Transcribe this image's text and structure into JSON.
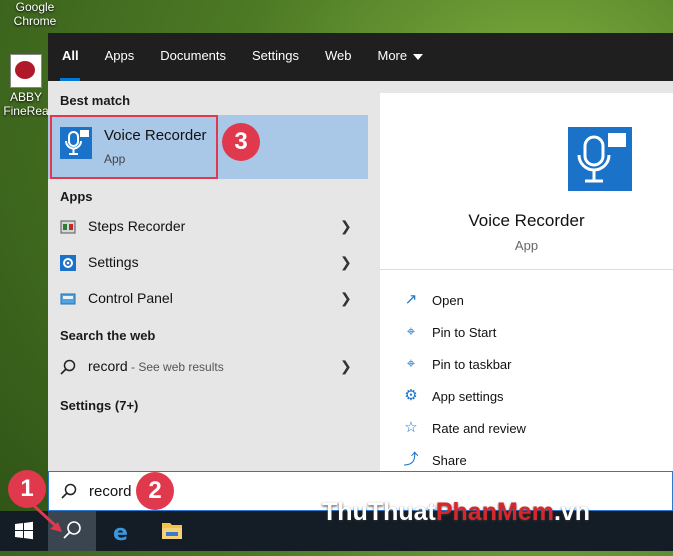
{
  "desktop": {
    "chrome_label": "Google Chrome",
    "abbyy_label_1": "ABBY",
    "abbyy_label_2": "FineRea"
  },
  "tabs": {
    "items": [
      {
        "label": "All"
      },
      {
        "label": "Apps"
      },
      {
        "label": "Documents"
      },
      {
        "label": "Settings"
      },
      {
        "label": "Web"
      },
      {
        "label": "More"
      }
    ]
  },
  "left": {
    "best_match_header": "Best match",
    "best": {
      "title": "Voice Recorder",
      "sub": "App"
    },
    "apps_header": "Apps",
    "apps": [
      {
        "label": "Steps Recorder"
      },
      {
        "label": "Settings"
      },
      {
        "label": "Control Panel"
      }
    ],
    "web_header": "Search the web",
    "web_query": "record",
    "web_hint": " - See web results",
    "settings_header": "Settings (7+)"
  },
  "right": {
    "title": "Voice Recorder",
    "sub": "App",
    "actions": [
      {
        "label": "Open",
        "icon": "open-icon"
      },
      {
        "label": "Pin to Start",
        "icon": "pin-icon"
      },
      {
        "label": "Pin to taskbar",
        "icon": "pin-icon"
      },
      {
        "label": "App settings",
        "icon": "gear-icon"
      },
      {
        "label": "Rate and review",
        "icon": "star-icon"
      },
      {
        "label": "Share",
        "icon": "share-icon"
      }
    ]
  },
  "search": {
    "value": "record"
  },
  "badges": {
    "one": "1",
    "two": "2",
    "three": "3"
  },
  "watermark": {
    "part1": "ThuThuat",
    "part2": "PhanMem",
    "part3": ".vn"
  },
  "colors": {
    "accent": "#0078d7",
    "highlight": "#e0394d",
    "selection": "#a9c8e8"
  }
}
